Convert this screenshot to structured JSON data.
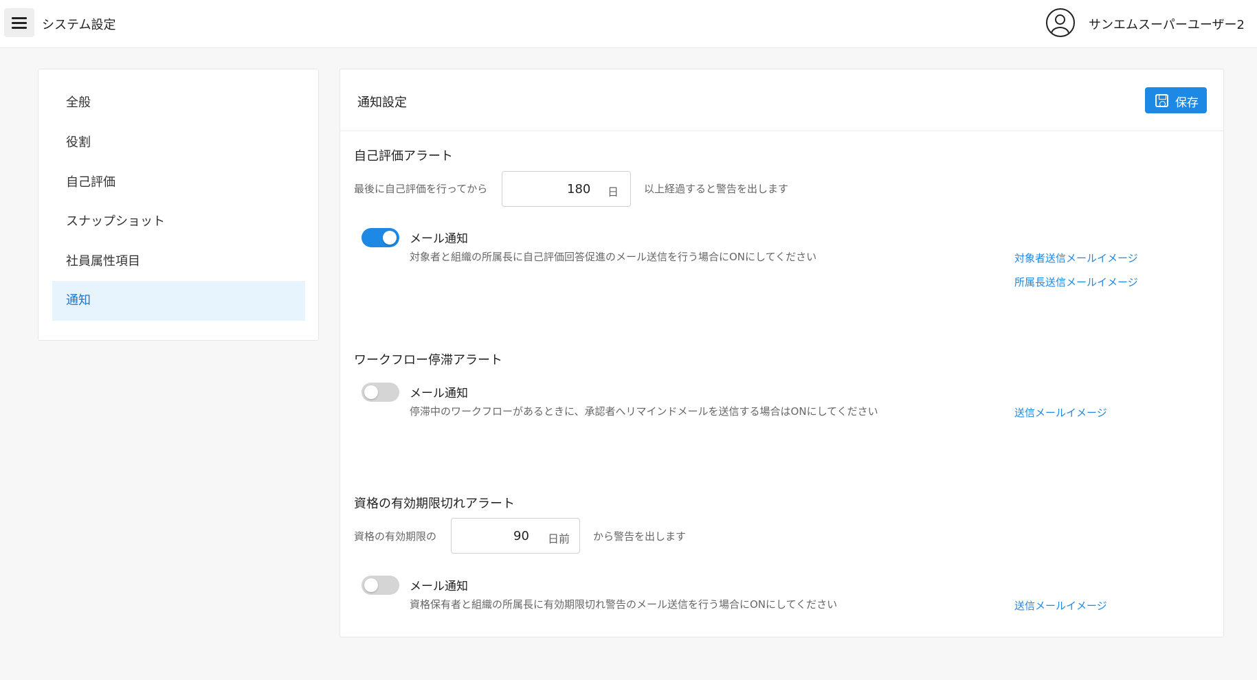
{
  "header": {
    "title": "システム設定",
    "menu_icon": "hamburger-icon",
    "avatar_icon": "user-circle-icon",
    "user_name": "サンエムスーパーユーザー2"
  },
  "sidebar": {
    "items": [
      {
        "label": "全般"
      },
      {
        "label": "役割"
      },
      {
        "label": "自己評価"
      },
      {
        "label": "スナップショット"
      },
      {
        "label": "社員属性項目"
      },
      {
        "label": "通知",
        "active": true
      }
    ]
  },
  "panel": {
    "title": "通知設定",
    "save_label": "保存",
    "save_icon": "floppy-disk-icon"
  },
  "self_eval_alert": {
    "title": "自己評価アラート",
    "prefix": "最後に自己評価を行ってから",
    "days_value": "180",
    "days_unit": "日",
    "suffix": "以上経過すると警告を出します",
    "mail_label": "メール通知",
    "mail_enabled": true,
    "mail_desc": "対象者と組織の所属長に自己評価回答促進のメール送信を行う場合にONにしてください",
    "link_target": "対象者送信メールイメージ",
    "link_manager": "所属長送信メールイメージ"
  },
  "workflow_alert": {
    "title": "ワークフロー停滞アラート",
    "mail_label": "メール通知",
    "mail_enabled": false,
    "mail_desc": "停滞中のワークフローがあるときに、承認者へリマインドメールを送信する場合はONにしてください",
    "link_mail": "送信メールイメージ"
  },
  "license_alert": {
    "title": "資格の有効期限切れアラート",
    "prefix": "資格の有効期限の",
    "days_value": "90",
    "days_unit": "日前",
    "suffix": "から警告を出します",
    "mail_label": "メール通知",
    "mail_enabled": false,
    "mail_desc": "資格保有者と組織の所属長に有効期限切れ警告のメール送信を行う場合にONにしてください",
    "link_mail": "送信メールイメージ"
  },
  "colors": {
    "accent": "#1e88e5",
    "active_nav_bg": "#e8f4fd",
    "page_bg": "#f7f7f7"
  }
}
